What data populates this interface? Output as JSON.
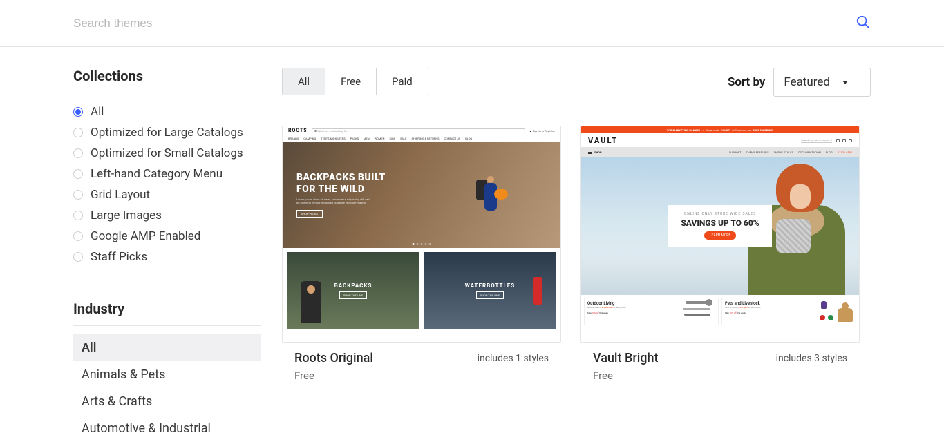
{
  "search": {
    "placeholder": "Search themes"
  },
  "sidebar": {
    "collections_heading": "Collections",
    "industry_heading": "Industry",
    "collections": [
      {
        "label": "All",
        "selected": true
      },
      {
        "label": "Optimized for Large Catalogs",
        "selected": false
      },
      {
        "label": "Optimized for Small Catalogs",
        "selected": false
      },
      {
        "label": "Left-hand Category Menu",
        "selected": false
      },
      {
        "label": "Grid Layout",
        "selected": false
      },
      {
        "label": "Large Images",
        "selected": false
      },
      {
        "label": "Google AMP Enabled",
        "selected": false
      },
      {
        "label": "Staff Picks",
        "selected": false
      }
    ],
    "industries": [
      {
        "label": "All",
        "active": true
      },
      {
        "label": "Animals & Pets",
        "active": false
      },
      {
        "label": "Arts & Crafts",
        "active": false
      },
      {
        "label": "Automotive & Industrial",
        "active": false
      }
    ]
  },
  "filter": {
    "tabs": [
      {
        "label": "All",
        "active": true
      },
      {
        "label": "Free",
        "active": false
      },
      {
        "label": "Paid",
        "active": false
      }
    ],
    "sort_label": "Sort by",
    "sort_value": "Featured"
  },
  "themes": [
    {
      "name": "Roots Original",
      "price": "Free",
      "styles_text": "includes 1 styles",
      "preview": {
        "logo": "ROOTS",
        "search_placeholder": "What are you looking for?",
        "account": "Sign in or Register",
        "nav": [
          "BRANDS",
          "CAMPING",
          "TENTS & SHELTERS",
          "PACKS",
          "MEN",
          "WOMEN",
          "KIDS",
          "SALE",
          "SHIPPING & RETURNS",
          "CONTACT US",
          "BLOG"
        ],
        "hero_title_1": "BACKPACKS BUILT",
        "hero_title_2": "FOR THE WILD",
        "hero_sub": "Lorem ipsum dolor sit amet, consectetur adipiscing elit, sed do eiusmod tempor incididunt ut labore et dolore magna.",
        "hero_button": "SHOP PACKS",
        "tile1_title": "BACKPACKS",
        "tile1_button": "SHOP THE LINE",
        "tile2_title": "WATERBOTTLES",
        "tile2_button": "SHOP THE LINE"
      }
    },
    {
      "name": "Vault Bright",
      "price": "Free",
      "styles_text": "includes 3 styles",
      "preview": {
        "banner_left": "TOP MARKETING BANNER",
        "banner_mid": "Enter code",
        "banner_code": "VAULT",
        "banner_mid2": "at Checkout for",
        "banner_right": "FREE SHIPPING!",
        "logo": "VAULT",
        "search_placeholder": "Search by name or part #",
        "shop_label": "SHOP",
        "nav": [
          "SUPPORT",
          "THEME FEATURES",
          "THEME STYLES",
          "DOCUMENTATION",
          "BLOG"
        ],
        "phone": "01123 4567",
        "hero_sub": "ONLINE ONLY STORE WIDE SALES",
        "hero_title": "SAVINGS UP TO 60%",
        "hero_button": "LEARN MORE",
        "cat1_title": "Outdoor Living",
        "cat1_sub1": "New Arrivals in",
        "cat1_sub_accent": "accessories",
        "cat1_sub2": "at best prices",
        "cat1_sale_prefix": "Sale",
        "cat1_sale_off": "10% off",
        "cat1_sale_suffix": "this week",
        "cat2_title": "Pets and Livestock",
        "cat2_sub1": "New Arrivals in",
        "cat2_sub_accent": "All Types",
        "cat2_sub2": "at best prices",
        "cat2_sale_prefix": "Sale",
        "cat2_sale_off": "10% off",
        "cat2_sale_suffix": "this week"
      }
    }
  ]
}
